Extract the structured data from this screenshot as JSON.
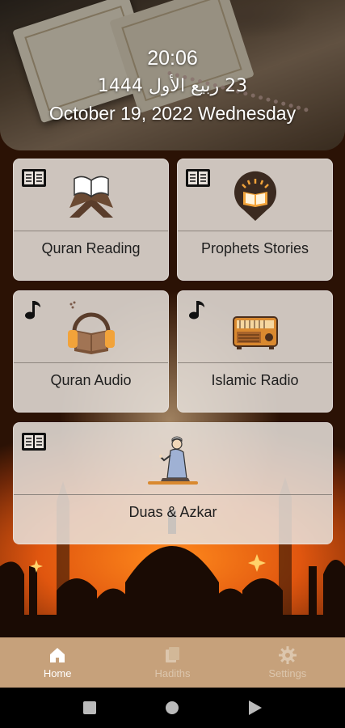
{
  "header": {
    "time": "20:06",
    "hijri_date": "23 ربيع الأول 1444",
    "gregorian_date": "October 19, 2022 Wednesday"
  },
  "cards": [
    {
      "label": "Quran Reading",
      "corner_icon": "book-open-icon",
      "icon": "quran-stand-icon"
    },
    {
      "label": "Prophets Stories",
      "corner_icon": "book-open-icon",
      "icon": "story-book-icon"
    },
    {
      "label": "Quran Audio",
      "corner_icon": "music-note-icon",
      "icon": "headphones-book-icon"
    },
    {
      "label": "Islamic Radio",
      "corner_icon": "music-note-icon",
      "icon": "radio-icon"
    },
    {
      "label": "Duas & Azkar",
      "corner_icon": "book-open-icon",
      "icon": "praying-man-icon"
    }
  ],
  "bottom_nav": {
    "items": [
      {
        "label": "Home",
        "icon": "home-icon",
        "active": true
      },
      {
        "label": "Hadiths",
        "icon": "pages-icon",
        "active": false
      },
      {
        "label": "Settings",
        "icon": "gear-icon",
        "active": false
      }
    ]
  },
  "colors": {
    "nav_bg": "#c6a17b",
    "card_bg": "#e8e2dc",
    "accent_orange": "#e0560f"
  }
}
